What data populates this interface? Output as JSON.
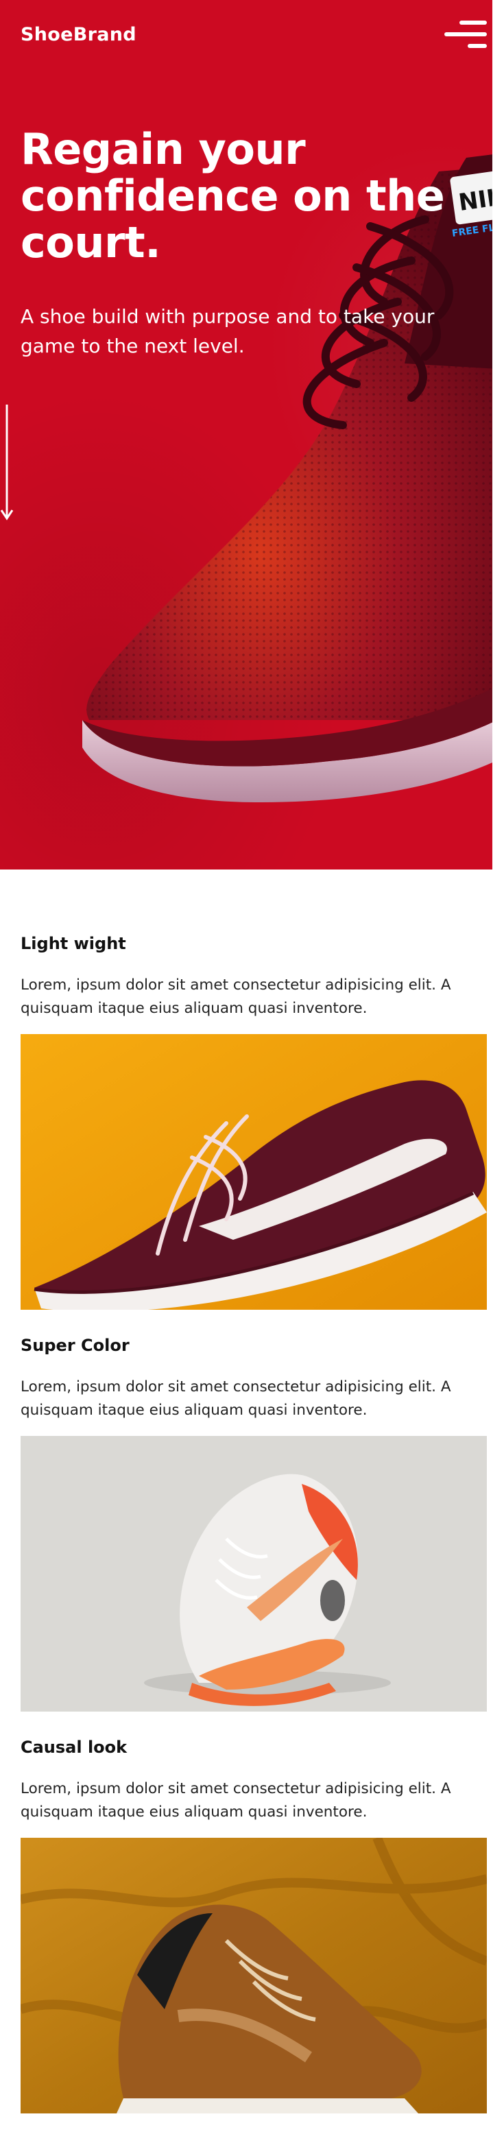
{
  "header": {
    "brand": "ShoeBrand",
    "menu_icon": "hamburger-menu-icon"
  },
  "hero": {
    "title": "Regain your confidence on the court.",
    "subtitle": "A shoe build with purpose and to take your game to the next level.",
    "scroll_icon": "arrow-down-icon",
    "shoe_brand_text": "NIKE",
    "shoe_line_text": "FREE FLY"
  },
  "features": [
    {
      "title": "Light wight",
      "text": "Lorem, ipsum dolor sit amet consectetur adipisicing elit. A quisquam itaque eius aliquam quasi inventore."
    },
    {
      "title": "Super Color",
      "text": "Lorem, ipsum dolor sit amet consectetur adipisicing elit. A quisquam itaque eius aliquam quasi inventore."
    },
    {
      "title": "Causal look",
      "text": "Lorem, ipsum dolor sit amet consectetur adipisicing elit. A quisquam itaque eius aliquam quasi inventore."
    }
  ],
  "colors": {
    "hero_red": "#cc0a22",
    "feature1_bg": "#f5a30c",
    "feature2_bg": "#d9d8d4",
    "feature3_bg": "#c98a1a"
  }
}
